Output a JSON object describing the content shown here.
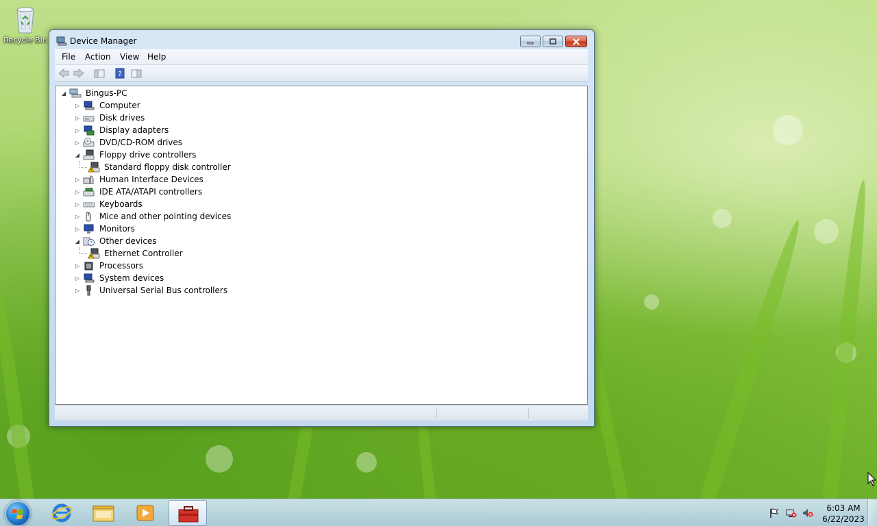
{
  "desktop": {
    "recycle_bin_label": "Recycle Bin"
  },
  "window": {
    "title": "Device Manager",
    "menu": [
      "File",
      "Action",
      "View",
      "Help"
    ]
  },
  "tree": {
    "root": "Bingus-PC",
    "items": [
      {
        "label": "Computer",
        "icon": "computer-icon",
        "state": "collapsed"
      },
      {
        "label": "Disk drives",
        "icon": "disk-drive-icon",
        "state": "collapsed"
      },
      {
        "label": "Display adapters",
        "icon": "display-adapter-icon",
        "state": "collapsed"
      },
      {
        "label": "DVD/CD-ROM drives",
        "icon": "dvd-drive-icon",
        "state": "collapsed"
      },
      {
        "label": "Floppy drive controllers",
        "icon": "floppy-controller-icon",
        "state": "expanded"
      },
      {
        "label": "Standard floppy disk controller",
        "icon": "warning-device-icon",
        "state": "child"
      },
      {
        "label": "Human Interface Devices",
        "icon": "hid-icon",
        "state": "collapsed"
      },
      {
        "label": "IDE ATA/ATAPI controllers",
        "icon": "ide-controller-icon",
        "state": "collapsed"
      },
      {
        "label": "Keyboards",
        "icon": "keyboard-icon",
        "state": "collapsed"
      },
      {
        "label": "Mice and other pointing devices",
        "icon": "mouse-icon",
        "state": "collapsed"
      },
      {
        "label": "Monitors",
        "icon": "monitor-icon",
        "state": "collapsed"
      },
      {
        "label": "Other devices",
        "icon": "other-devices-icon",
        "state": "expanded"
      },
      {
        "label": "Ethernet Controller",
        "icon": "warning-device-icon",
        "state": "child"
      },
      {
        "label": "Processors",
        "icon": "processor-icon",
        "state": "collapsed"
      },
      {
        "label": "System devices",
        "icon": "system-devices-icon",
        "state": "collapsed"
      },
      {
        "label": "Universal Serial Bus controllers",
        "icon": "usb-icon",
        "state": "collapsed"
      }
    ]
  },
  "taskbar": {
    "time": "6:03 AM",
    "date": "6/22/2023"
  }
}
